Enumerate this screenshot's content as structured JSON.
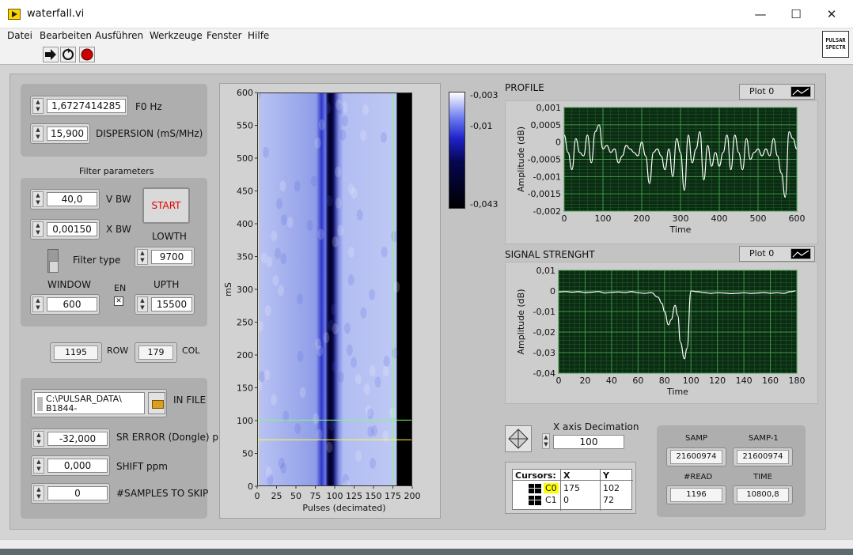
{
  "window": {
    "title": "waterfall.vi",
    "controls": {
      "minimize": "—",
      "maximize": "☐",
      "close": "✕"
    }
  },
  "menu": [
    "Datei",
    "Bearbeiten",
    "Ausführen",
    "Werkzeuge",
    "Fenster",
    "Hilfe"
  ],
  "toolbar": {
    "run_icon": "run-arrow-icon",
    "run_continuous_icon": "run-continuous-icon",
    "abort_icon": "abort-icon",
    "vi_icon_text": [
      "PULSAR",
      "SPECTR"
    ]
  },
  "params": {
    "f0": {
      "value": "1,6727414285",
      "label": "F0 Hz"
    },
    "dispersion": {
      "value": "15,900",
      "label": "DISPERSION (mS/MHz)"
    }
  },
  "filter": {
    "title": "Filter parameters",
    "vbw": {
      "value": "40,0",
      "label": "V BW"
    },
    "xbw": {
      "value": "0,00150",
      "label": "X BW"
    },
    "start_label": "START",
    "lowth": {
      "value": "9700",
      "label": "LOWTH"
    },
    "filter_type_label": "Filter type",
    "window": {
      "value": "600",
      "label": "WINDOW"
    },
    "en_label": "EN",
    "en_checked": true,
    "upth": {
      "value": "15500",
      "label": "UPTH"
    }
  },
  "rowcol": {
    "row": {
      "value": "1195",
      "label": "ROW"
    },
    "col": {
      "value": "179",
      "label": "COL"
    }
  },
  "input": {
    "file_path": [
      "C:\\PULSAR_DATA\\",
      "B1844-"
    ],
    "file_label": "IN FILE",
    "sr_error": {
      "value": "-32,000",
      "label": "SR ERROR (Dongle) ppm"
    },
    "shift": {
      "value": "0,000",
      "label": "SHIFT ppm"
    },
    "samples_to_skip": {
      "value": "0",
      "label": "#SAMPLES TO SKIP"
    }
  },
  "waterfall": {
    "ylabel": "mS",
    "xlabel": "Pulses (decimated)",
    "yticks": [
      "600",
      "550",
      "500",
      "450",
      "400",
      "350",
      "300",
      "250",
      "200",
      "150",
      "100",
      "50",
      "0"
    ],
    "xticks": [
      "0",
      "25",
      "50",
      "75",
      "100",
      "125",
      "150",
      "175",
      "200"
    ],
    "colorbar_ticks": [
      "-0,003",
      "-0,01",
      "-0,043"
    ],
    "cursor_c0_y": 102,
    "cursor_c1_y": 72
  },
  "profile": {
    "title": "PROFILE",
    "legend": "Plot 0",
    "ylabel": "Amplitude (dB)",
    "xlabel": "Time",
    "yticks": [
      "0,001",
      "0,0005",
      "0",
      "-0,0005",
      "-0,001",
      "-0,0015",
      "-0,002"
    ],
    "xticks": [
      "0",
      "100",
      "200",
      "300",
      "400",
      "500",
      "600"
    ]
  },
  "signal": {
    "title": "SIGNAL STRENGHT",
    "legend": "Plot 0",
    "ylabel": "Amplitude (dB)",
    "xlabel": "Time",
    "yticks": [
      "0,01",
      "0",
      "-0,01",
      "-0,02",
      "-0,03",
      "-0,04"
    ],
    "xticks": [
      "0",
      "20",
      "40",
      "60",
      "80",
      "100",
      "120",
      "140",
      "160",
      "180"
    ]
  },
  "decimation": {
    "label": "X axis Decimation",
    "value": "100"
  },
  "cursors": {
    "header": [
      "Cursors:",
      "X",
      "Y"
    ],
    "rows": [
      {
        "name": "C0",
        "x": "175",
        "y": "102"
      },
      {
        "name": "C1",
        "x": "0",
        "y": "72"
      }
    ]
  },
  "stats": {
    "samp": {
      "label": "SAMP",
      "value": "21600974"
    },
    "samp1": {
      "label": "SAMP-1",
      "value": "21600974"
    },
    "read": {
      "label": "#READ",
      "value": "1196"
    },
    "time": {
      "label": "TIME",
      "value": "10800,8"
    }
  },
  "chart_data": [
    {
      "type": "heatmap",
      "title": "",
      "xlabel": "Pulses (decimated)",
      "ylabel": "mS",
      "xlim": [
        0,
        200
      ],
      "ylim": [
        0,
        600
      ],
      "data_extent_x": 179,
      "color_scale": {
        "min": -0.043,
        "max": -0.003,
        "ticks": [
          -0.003,
          -0.01,
          -0.043
        ]
      },
      "dark_band_x": [
        90,
        97
      ],
      "diffuse_band_x": [
        75,
        100
      ],
      "cursors": [
        {
          "name": "C0",
          "x": 175,
          "y": 102
        },
        {
          "name": "C1",
          "x": 0,
          "y": 72
        }
      ]
    },
    {
      "type": "line",
      "title": "PROFILE",
      "xlabel": "Time",
      "ylabel": "Amplitude (dB)",
      "xlim": [
        0,
        600
      ],
      "ylim": [
        -0.002,
        0.001
      ],
      "grid": true,
      "series": [
        {
          "name": "Plot 0",
          "x": [
            0,
            10,
            20,
            30,
            40,
            50,
            60,
            70,
            80,
            90,
            100,
            110,
            120,
            130,
            140,
            150,
            160,
            170,
            180,
            190,
            200,
            210,
            220,
            230,
            240,
            250,
            260,
            270,
            280,
            290,
            300,
            310,
            320,
            330,
            340,
            350,
            360,
            370,
            380,
            390,
            400,
            410,
            420,
            430,
            440,
            450,
            460,
            470,
            480,
            490,
            500,
            510,
            520,
            530,
            540,
            550,
            560,
            570,
            580,
            590,
            600
          ],
          "y": [
            0.0002,
            -0.0003,
            -0.0008,
            0.0001,
            -0.0003,
            -0.0004,
            0.0002,
            -0.0006,
            0.0003,
            0.0005,
            -0.0002,
            -0.0001,
            -0.0003,
            -0.0002,
            -0.0006,
            -0.0004,
            -0.0001,
            -0.0002,
            -0.0003,
            -0.0004,
            0.0,
            -0.0004,
            -0.0012,
            -0.0003,
            -0.0002,
            -0.0004,
            -0.0008,
            -0.0002,
            -0.001,
            0.0001,
            -0.0003,
            -0.0014,
            0.0002,
            -0.0006,
            -0.0002,
            0.0003,
            -0.0011,
            -0.0001,
            -0.0007,
            -0.0003,
            -0.0007,
            -0.0003,
            0.0002,
            -0.0008,
            0.0002,
            -0.0003,
            -0.0008,
            0.0001,
            -0.0005,
            -0.0003,
            -0.0002,
            -0.0004,
            -0.0002,
            -0.0004,
            0.0001,
            -0.0004,
            -0.0009,
            -0.0016,
            0.0003,
            0.0001,
            -0.0002
          ]
        }
      ]
    },
    {
      "type": "line",
      "title": "SIGNAL STRENGHT",
      "xlabel": "Time",
      "ylabel": "Amplitude (dB)",
      "xlim": [
        0,
        180
      ],
      "ylim": [
        -0.04,
        0.01
      ],
      "grid": true,
      "series": [
        {
          "name": "Plot 0",
          "x": [
            0,
            5,
            10,
            15,
            20,
            25,
            30,
            35,
            40,
            45,
            50,
            55,
            60,
            65,
            70,
            75,
            78,
            80,
            83,
            85,
            88,
            90,
            92,
            95,
            97,
            100,
            105,
            110,
            115,
            120,
            125,
            130,
            135,
            140,
            145,
            150,
            155,
            160,
            165,
            170,
            175,
            179
          ],
          "y": [
            -0.0005,
            -0.0003,
            -0.0006,
            -0.0004,
            -0.0008,
            -0.0006,
            -0.0003,
            -0.001,
            -0.0007,
            -0.0005,
            -0.0008,
            -0.0004,
            -0.0009,
            -0.0012,
            -0.0008,
            -0.003,
            -0.006,
            -0.01,
            -0.0165,
            -0.014,
            -0.007,
            -0.012,
            -0.025,
            -0.033,
            -0.028,
            0.0,
            -0.0004,
            -0.0008,
            -0.0012,
            -0.0009,
            -0.001,
            -0.0013,
            -0.0011,
            -0.0009,
            -0.0012,
            -0.001,
            -0.0008,
            -0.0011,
            -0.0009,
            -0.0012,
            -0.0004,
            0.0
          ]
        }
      ]
    }
  ]
}
